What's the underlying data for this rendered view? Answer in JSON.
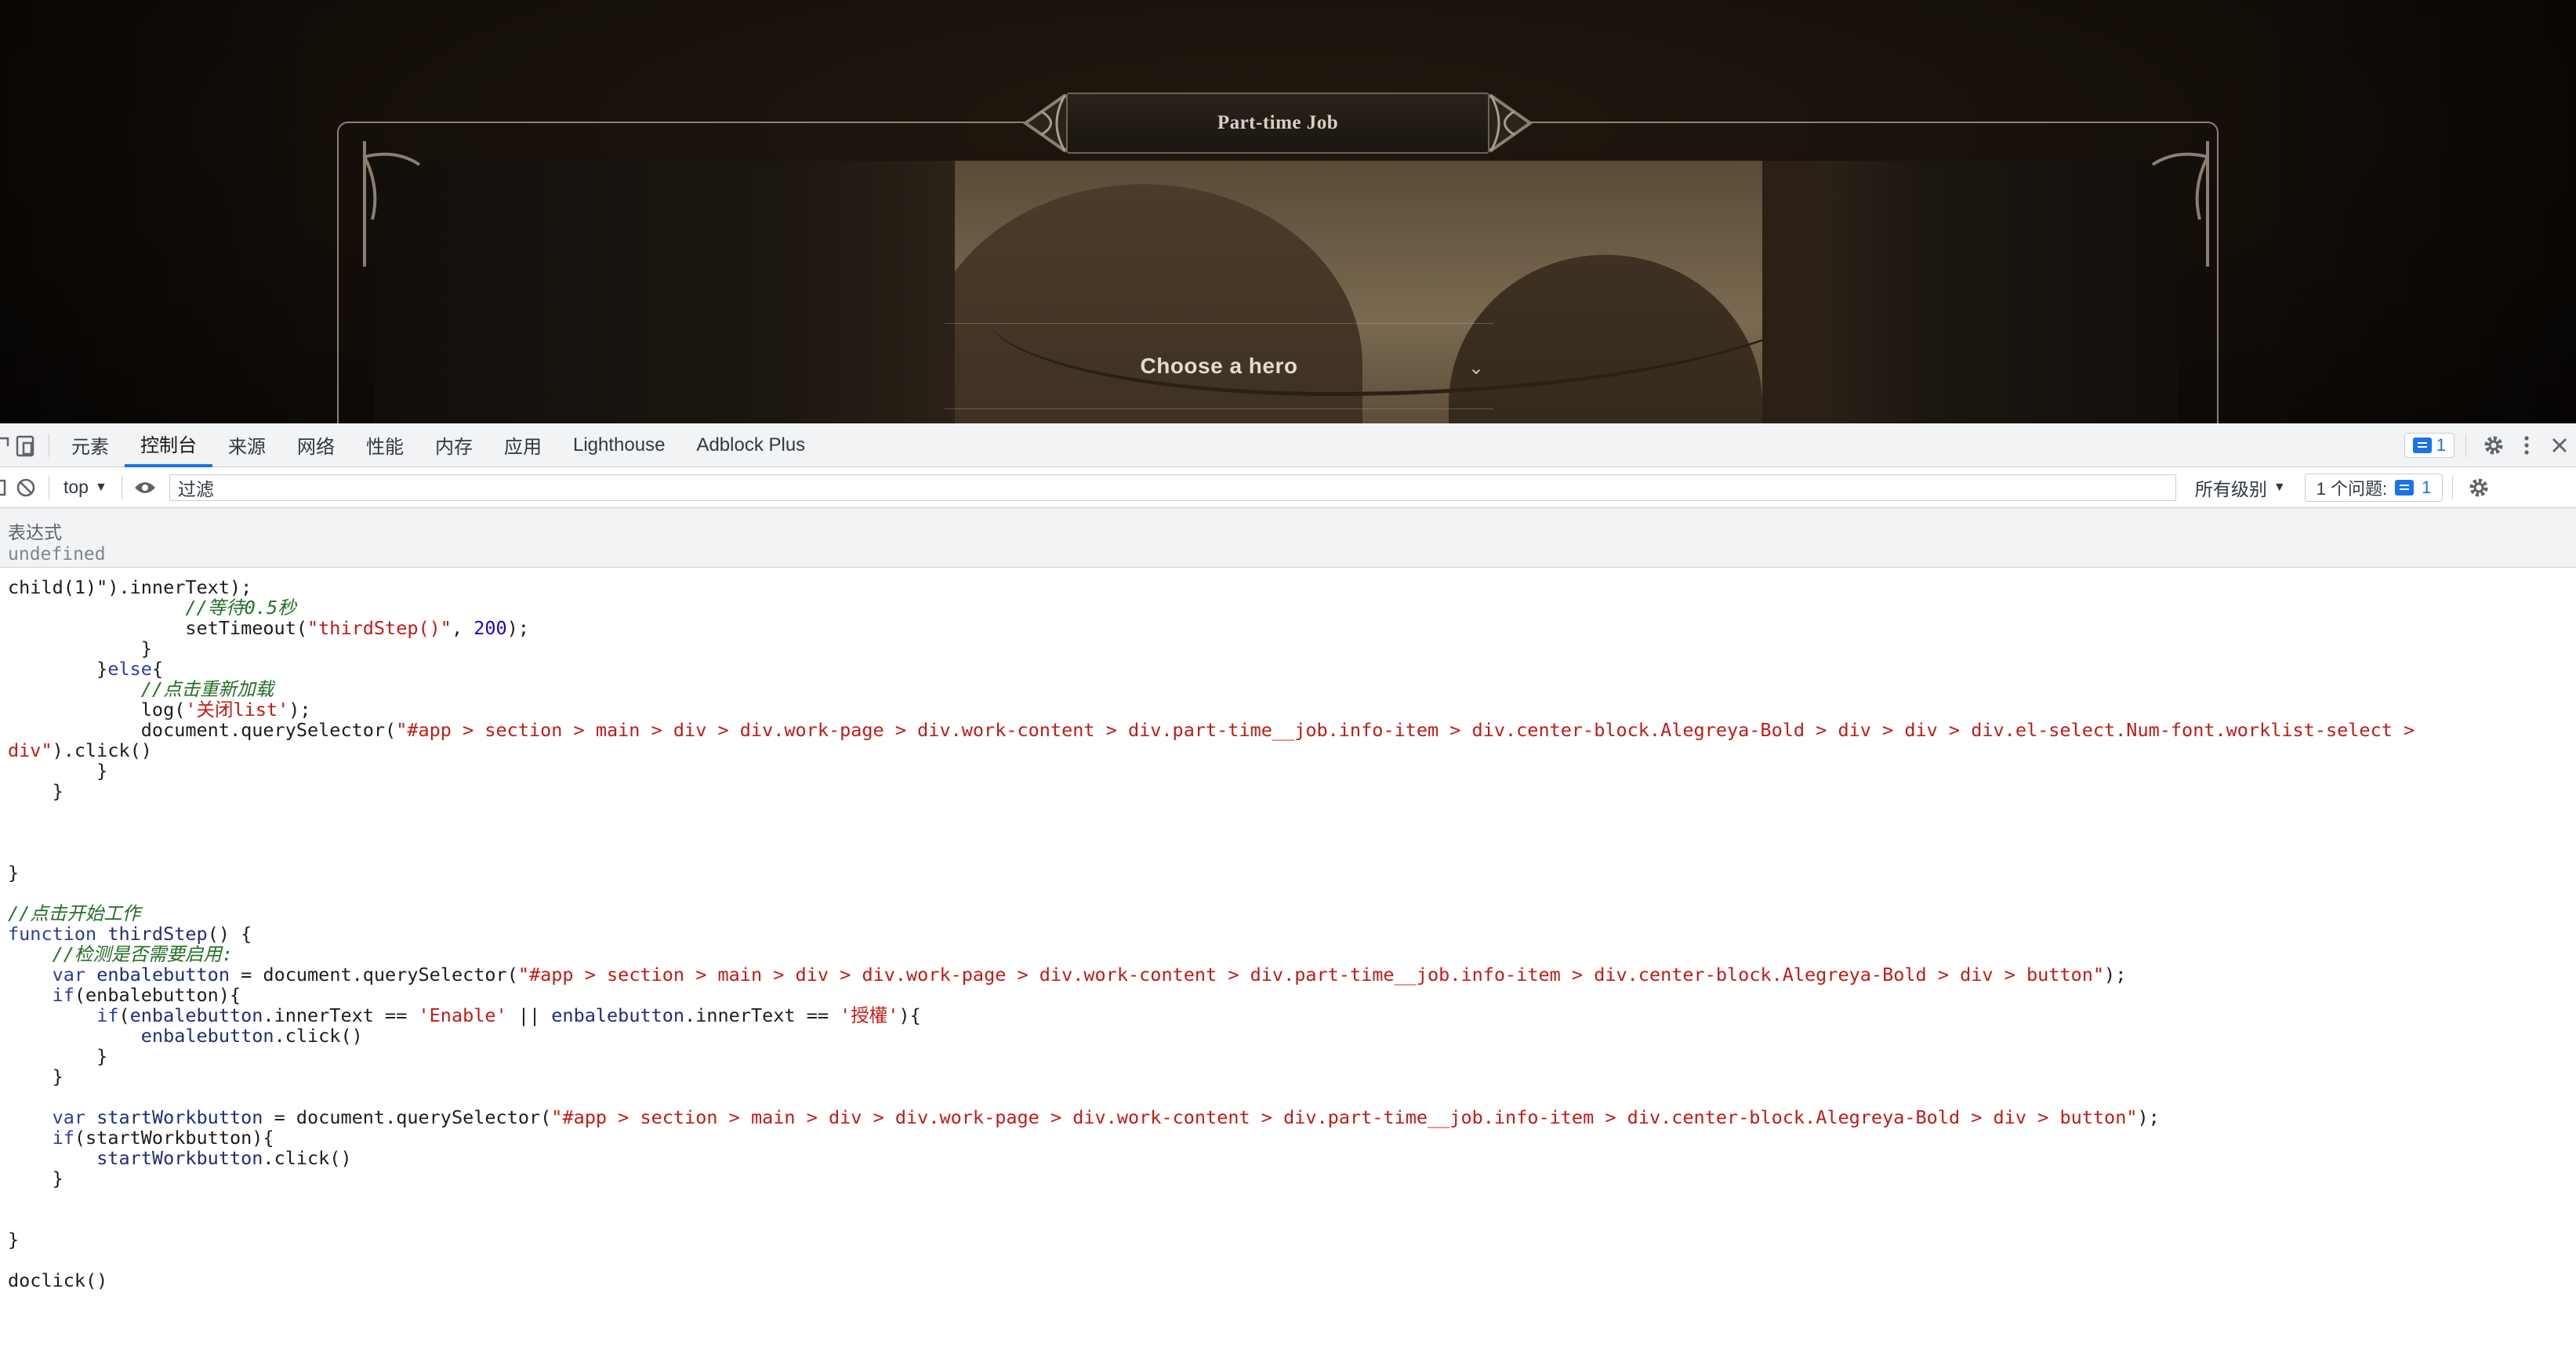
{
  "game": {
    "panel_title": "Part-time Job",
    "hero_select_label": "Choose a hero"
  },
  "devtools": {
    "tabs": [
      "元素",
      "控制台",
      "来源",
      "网络",
      "性能",
      "内存",
      "应用",
      "Lighthouse",
      "Adblock Plus"
    ],
    "active_tab": "控制台",
    "issues_badge_count": "1",
    "context_selector": "top",
    "filter_placeholder": "过滤",
    "level_selector": "所有级别",
    "issues_label": "1 个问题:",
    "issues_count": "1",
    "expression_label": "表达式",
    "expression_value": "undefined"
  },
  "code_lines": [
    [
      {
        "t": "child(1)\").innerText);"
      }
    ],
    [
      {
        "t": "                "
      },
      {
        "t": "//等待0.5秒",
        "c": "cm"
      }
    ],
    [
      {
        "t": "                setTimeout("
      },
      {
        "t": "\"thirdStep()\"",
        "c": "str"
      },
      {
        "t": ", "
      },
      {
        "t": "200",
        "c": "num"
      },
      {
        "t": ");"
      }
    ],
    [
      {
        "t": "            }"
      }
    ],
    [
      {
        "t": "        }"
      },
      {
        "t": "else",
        "c": "kw"
      },
      {
        "t": "{"
      }
    ],
    [
      {
        "t": "            "
      },
      {
        "t": "//点击重新加载",
        "c": "cm"
      }
    ],
    [
      {
        "t": "            log("
      },
      {
        "t": "'关闭list'",
        "c": "str"
      },
      {
        "t": ");"
      }
    ],
    [
      {
        "t": "            document.querySelector("
      },
      {
        "t": "\"#app > section > main > div > div.work-page > div.work-content > div.part-time__job.info-item > div.center-block.Alegreya-Bold > div > div > div.el-select.Num-font.worklist-select >",
        "c": "str"
      }
    ],
    [
      {
        "t": "div\"",
        "c": "str"
      },
      {
        "t": ").click()"
      }
    ],
    [
      {
        "t": "        }"
      }
    ],
    [
      {
        "t": "    }"
      }
    ],
    [
      {
        "t": ""
      }
    ],
    [
      {
        "t": ""
      }
    ],
    [
      {
        "t": ""
      }
    ],
    [
      {
        "t": "}"
      }
    ],
    [
      {
        "t": ""
      }
    ],
    [
      {
        "t": "//点击开始工作",
        "c": "cm"
      }
    ],
    [
      {
        "t": "function",
        "c": "kw"
      },
      {
        "t": " "
      },
      {
        "t": "thirdStep",
        "c": "fn"
      },
      {
        "t": "() {"
      }
    ],
    [
      {
        "t": "    "
      },
      {
        "t": "//检测是否需要启用:",
        "c": "cm"
      }
    ],
    [
      {
        "t": "    "
      },
      {
        "t": "var",
        "c": "kw"
      },
      {
        "t": " "
      },
      {
        "t": "enbalebutton",
        "c": "fn"
      },
      {
        "t": " = document.querySelector("
      },
      {
        "t": "\"#app > section > main > div > div.work-page > div.work-content > div.part-time__job.info-item > div.center-block.Alegreya-Bold > div > button\"",
        "c": "str"
      },
      {
        "t": ");"
      }
    ],
    [
      {
        "t": "    "
      },
      {
        "t": "if",
        "c": "kw"
      },
      {
        "t": "(enbalebutton){"
      }
    ],
    [
      {
        "t": "        "
      },
      {
        "t": "if",
        "c": "kw"
      },
      {
        "t": "("
      },
      {
        "t": "enbalebutton",
        "c": "fn"
      },
      {
        "t": ".innerText == "
      },
      {
        "t": "'Enable'",
        "c": "str"
      },
      {
        "t": " || "
      },
      {
        "t": "enbalebutton",
        "c": "fn"
      },
      {
        "t": ".innerText == "
      },
      {
        "t": "'授權'",
        "c": "str"
      },
      {
        "t": "){"
      }
    ],
    [
      {
        "t": "            "
      },
      {
        "t": "enbalebutton",
        "c": "fn"
      },
      {
        "t": ".click()"
      }
    ],
    [
      {
        "t": "        }"
      }
    ],
    [
      {
        "t": "    }"
      }
    ],
    [
      {
        "t": ""
      }
    ],
    [
      {
        "t": "    "
      },
      {
        "t": "var",
        "c": "kw"
      },
      {
        "t": " "
      },
      {
        "t": "startWorkbutton",
        "c": "fn"
      },
      {
        "t": " = document.querySelector("
      },
      {
        "t": "\"#app > section > main > div > div.work-page > div.work-content > div.part-time__job.info-item > div.center-block.Alegreya-Bold > div > button\"",
        "c": "str"
      },
      {
        "t": ");"
      }
    ],
    [
      {
        "t": "    "
      },
      {
        "t": "if",
        "c": "kw"
      },
      {
        "t": "(startWorkbutton){"
      }
    ],
    [
      {
        "t": "        "
      },
      {
        "t": "startWorkbutton",
        "c": "fn"
      },
      {
        "t": ".click()"
      }
    ],
    [
      {
        "t": "    }"
      }
    ],
    [
      {
        "t": ""
      }
    ],
    [
      {
        "t": ""
      }
    ],
    [
      {
        "t": "}"
      }
    ],
    [
      {
        "t": ""
      }
    ],
    [
      {
        "t": "doclick()"
      }
    ]
  ],
  "colors": {
    "accent": "#1a73e8",
    "comment": "#236e25",
    "string": "#c41a16",
    "keyword": "#2c3ea0"
  }
}
